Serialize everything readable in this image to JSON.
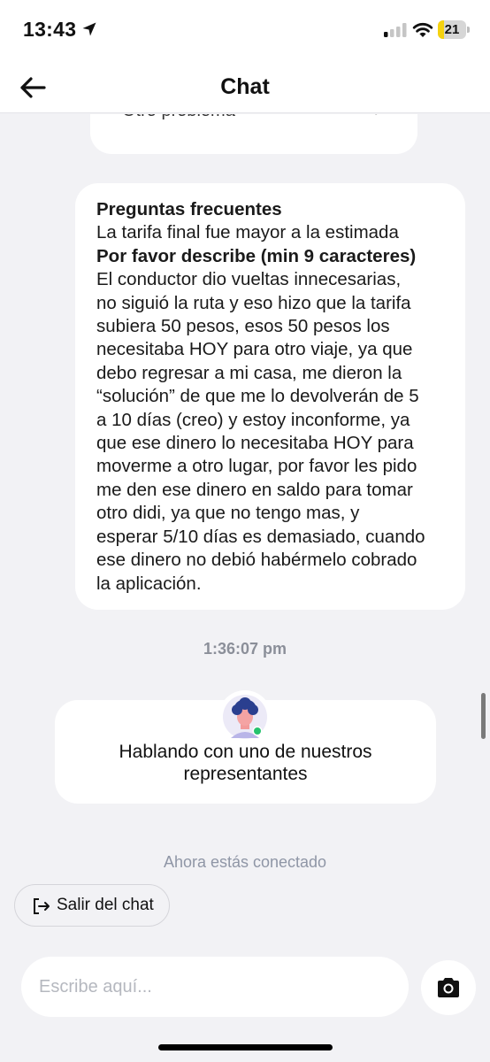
{
  "status_bar": {
    "time": "13:43",
    "battery_level": "21",
    "battery_fraction": 0.21,
    "icons": [
      "location-arrow-icon",
      "cellular-signal-icon",
      "wifi-icon",
      "battery-icon"
    ],
    "battery_color": "#f5d20f"
  },
  "header": {
    "title": "Chat",
    "back_icon": "arrow-left-icon"
  },
  "chat": {
    "previous_option": {
      "label": "Otro problema",
      "chevron": "›"
    },
    "user_message": {
      "category_label": "Preguntas frecuentes",
      "issue": "La tarifa final fue mayor a la estimada",
      "prompt_label": "Por favor describe (min 9 caracteres)",
      "lines": [
        "El conductor dio vueltas innecesarias,",
        "no siguió la ruta y eso hizo que la tarifa",
        "subiera 50 pesos, esos 50 pesos los",
        "necesitaba HOY para otro viaje, ya que",
        "debo regresar a mi casa, me dieron la",
        "“solución” de que me lo devolverán de 5",
        "a 10 días (creo) y estoy inconforme, ya",
        "que ese dinero lo necesitaba HOY para",
        "moverme a otro lugar, por favor les pido",
        "me den ese dinero en saldo para tomar",
        "otro didi, ya que no tengo mas, y",
        "esperar 5/10 días es demasiado, cuando",
        "ese dinero no debió habérmelo cobrado",
        "la aplicación."
      ]
    },
    "timestamp": "1:36:07 pm",
    "agent_card": {
      "text": "Hablando con uno de nuestros representantes",
      "avatar_icon": "agent-avatar-icon",
      "online_color": "#25c26e"
    },
    "connected_status": "Ahora estás conectado",
    "leave_button": {
      "label": "Salir del chat",
      "icon": "exit-icon"
    }
  },
  "composer": {
    "placeholder": "Escribe aquí...",
    "value": "",
    "camera_icon": "camera-icon"
  }
}
